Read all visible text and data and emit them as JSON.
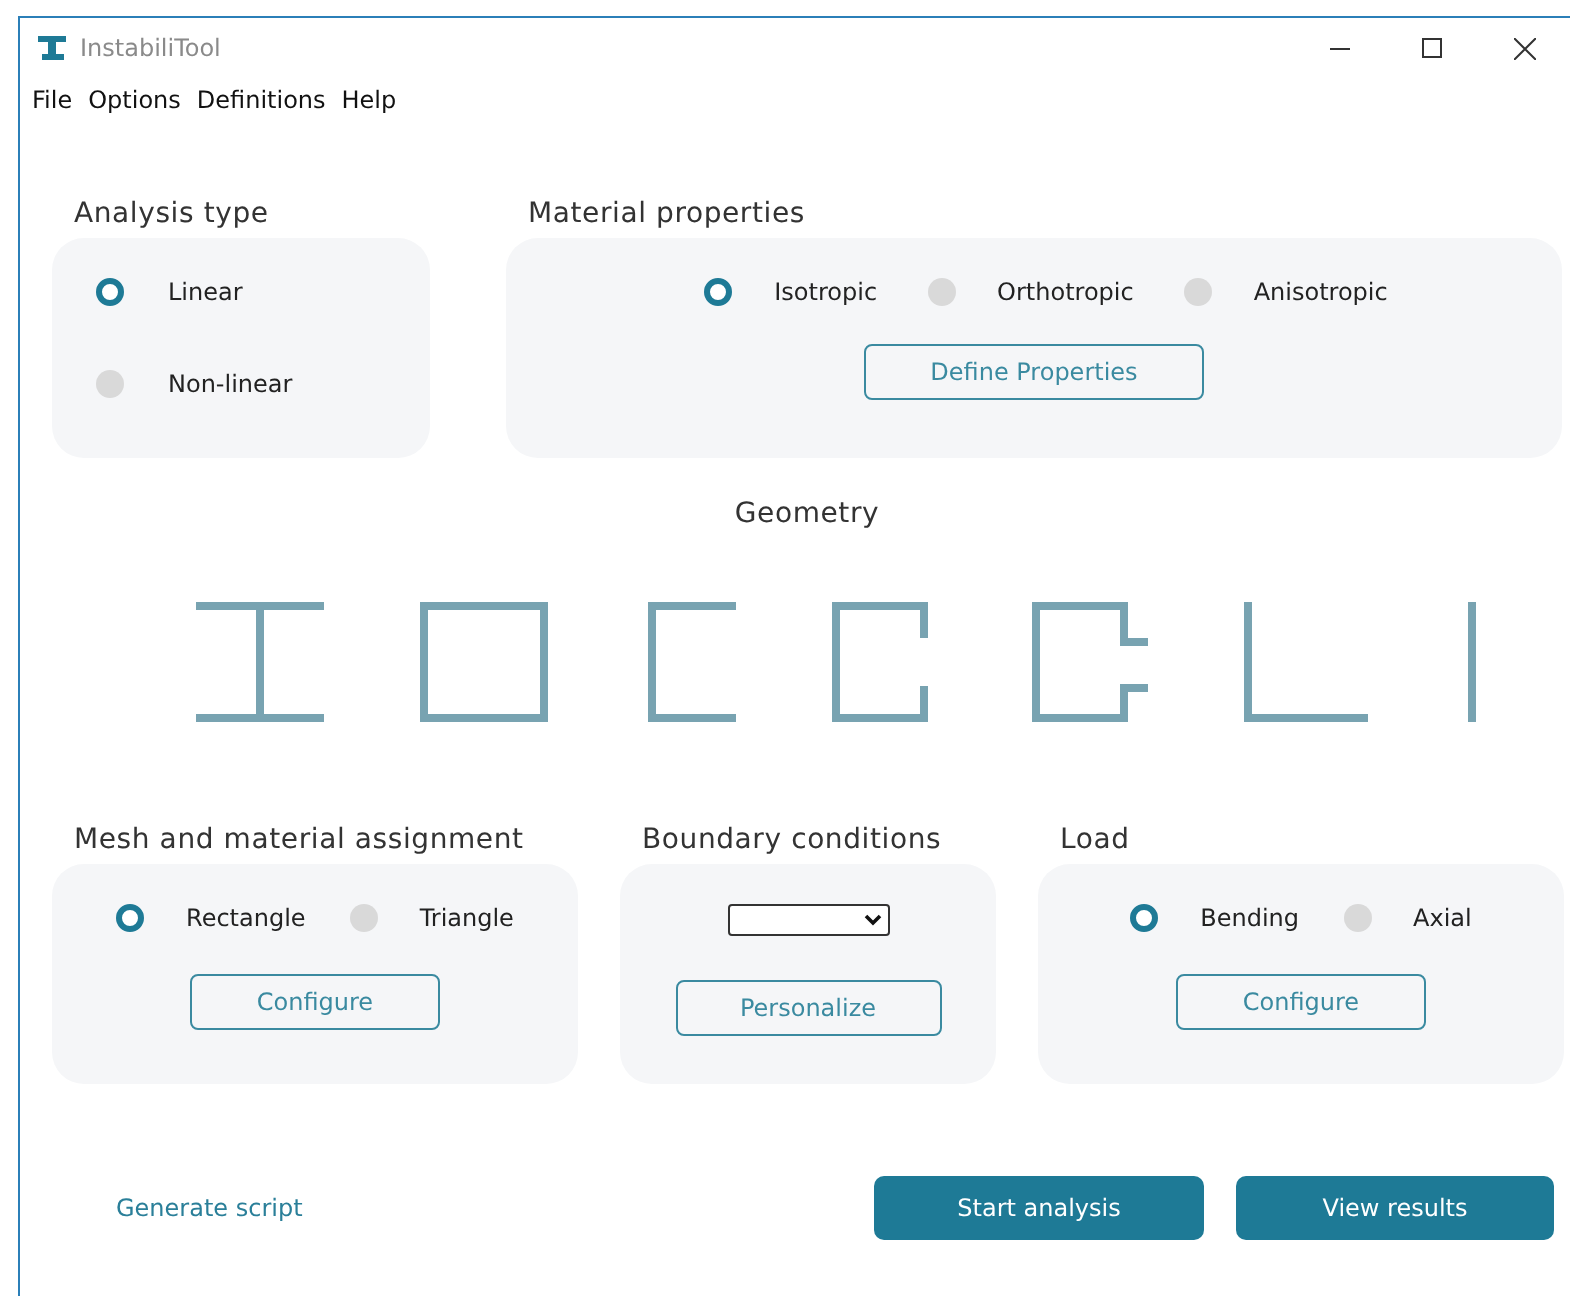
{
  "window": {
    "title": "InstabiliTool"
  },
  "menu": [
    "File",
    "Options",
    "Definitions",
    "Help"
  ],
  "analysis_type": {
    "title": "Analysis type",
    "options": [
      {
        "label": "Linear",
        "selected": true
      },
      {
        "label": "Non-linear",
        "selected": false
      }
    ]
  },
  "material_properties": {
    "title": "Material properties",
    "options": [
      {
        "label": "Isotropic",
        "selected": true
      },
      {
        "label": "Orthotropic",
        "selected": false
      },
      {
        "label": "Anisotropic",
        "selected": false
      }
    ],
    "button": "Define Properties"
  },
  "geometry": {
    "title": "Geometry"
  },
  "mesh": {
    "title": "Mesh and material assignment",
    "options": [
      {
        "label": "Rectangle",
        "selected": true
      },
      {
        "label": "Triangle",
        "selected": false
      }
    ],
    "button": "Configure"
  },
  "boundary_conditions": {
    "title": "Boundary conditions",
    "button": "Personalize"
  },
  "load": {
    "title": "Load",
    "options": [
      {
        "label": "Bending",
        "selected": true
      },
      {
        "label": "Axial",
        "selected": false
      }
    ],
    "button": "Configure"
  },
  "footer": {
    "link": "Generate script",
    "buttons": [
      "Start analysis",
      "View results"
    ]
  }
}
